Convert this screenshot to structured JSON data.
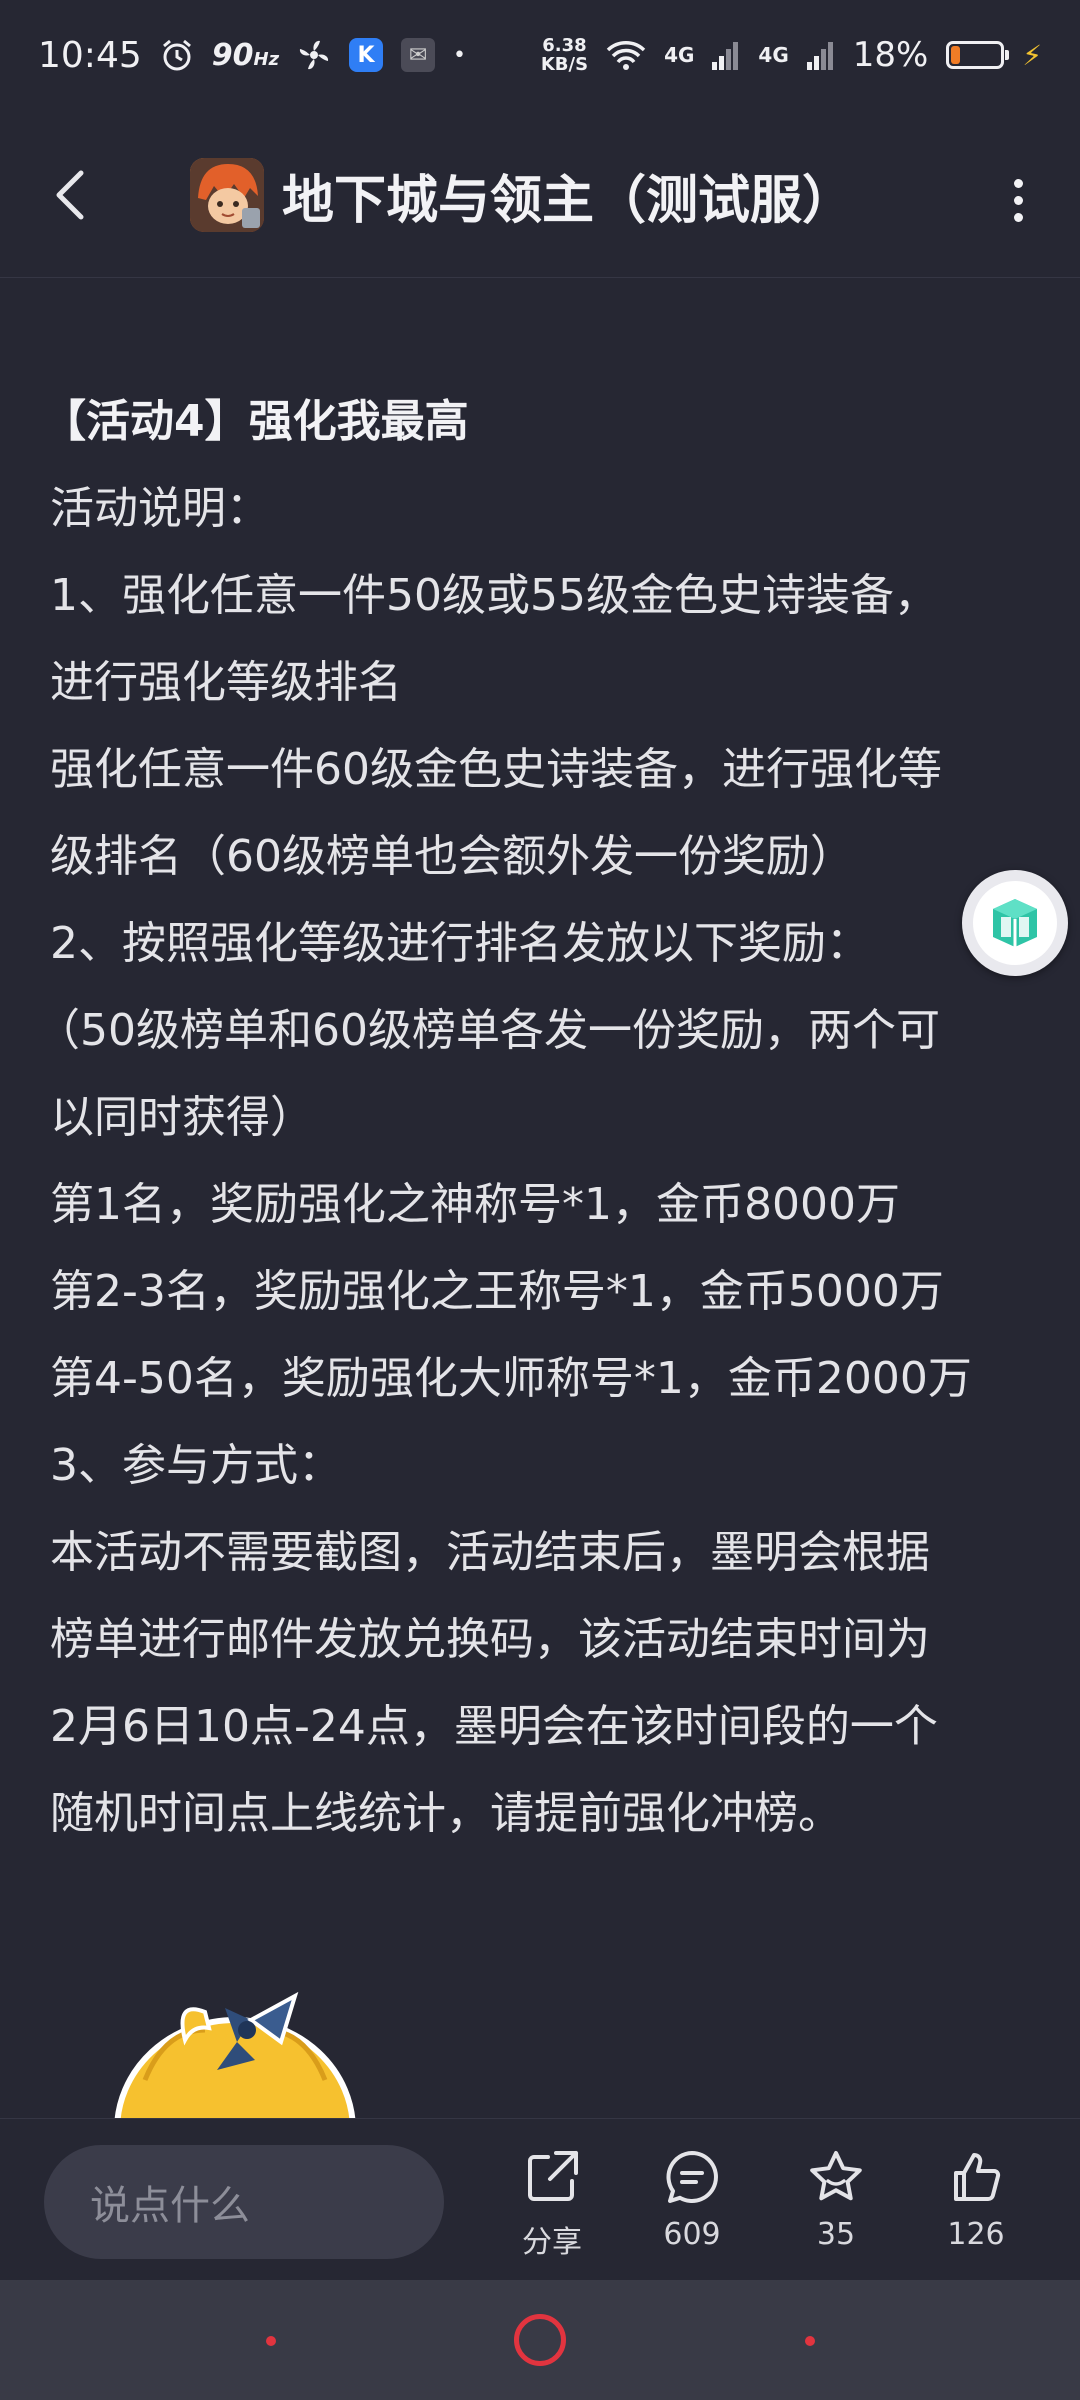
{
  "status_bar": {
    "time": "10:45",
    "refresh_rate": "90",
    "refresh_unit": "Hz",
    "speed_value": "6.38",
    "speed_unit": "KB/S",
    "signal1_label": "4G",
    "signal2_label": "4G",
    "battery_percent": "18%",
    "battery_level": 0.18,
    "battery_color": "#f07c26"
  },
  "header": {
    "title": "地下城与领主（测试服）",
    "back_icon": "chevron-left-icon",
    "more_icon": "more-vertical-icon"
  },
  "post": {
    "lines": [
      "【活动4】强化我最高",
      "活动说明：",
      "1、强化任意一件50级或55级金色史诗装备，",
      "进行强化等级排名",
      "强化任意一件60级金色史诗装备，进行强化等",
      "级排名（60级榜单也会额外发一份奖励）",
      "2、按照强化等级进行排名发放以下奖励：",
      "（50级榜单和60级榜单各发一份奖励，两个可",
      "以同时获得）",
      "第1名，奖励强化之神称号*1，金币8000万",
      "第2-3名，奖励强化之王称号*1，金币5000万",
      "第4-50名，奖励强化大师称号*1，金币2000万",
      "3、参与方式：",
      "本活动不需要截图，活动结束后，墨明会根据",
      "榜单进行邮件发放兑换码，该活动结束时间为",
      "2月6日10点-24点，墨明会在该时间段的一个",
      "随机时间点上线统计，请提前强化冲榜。"
    ]
  },
  "action_bar": {
    "input_placeholder": "说点什么",
    "share_label": "分享",
    "comments_count": "609",
    "favorites_count": "35",
    "likes_count": "126"
  },
  "colors": {
    "background": "#262733",
    "accent_red": "#e2343f",
    "floating_accent": "#2ec4a6"
  }
}
